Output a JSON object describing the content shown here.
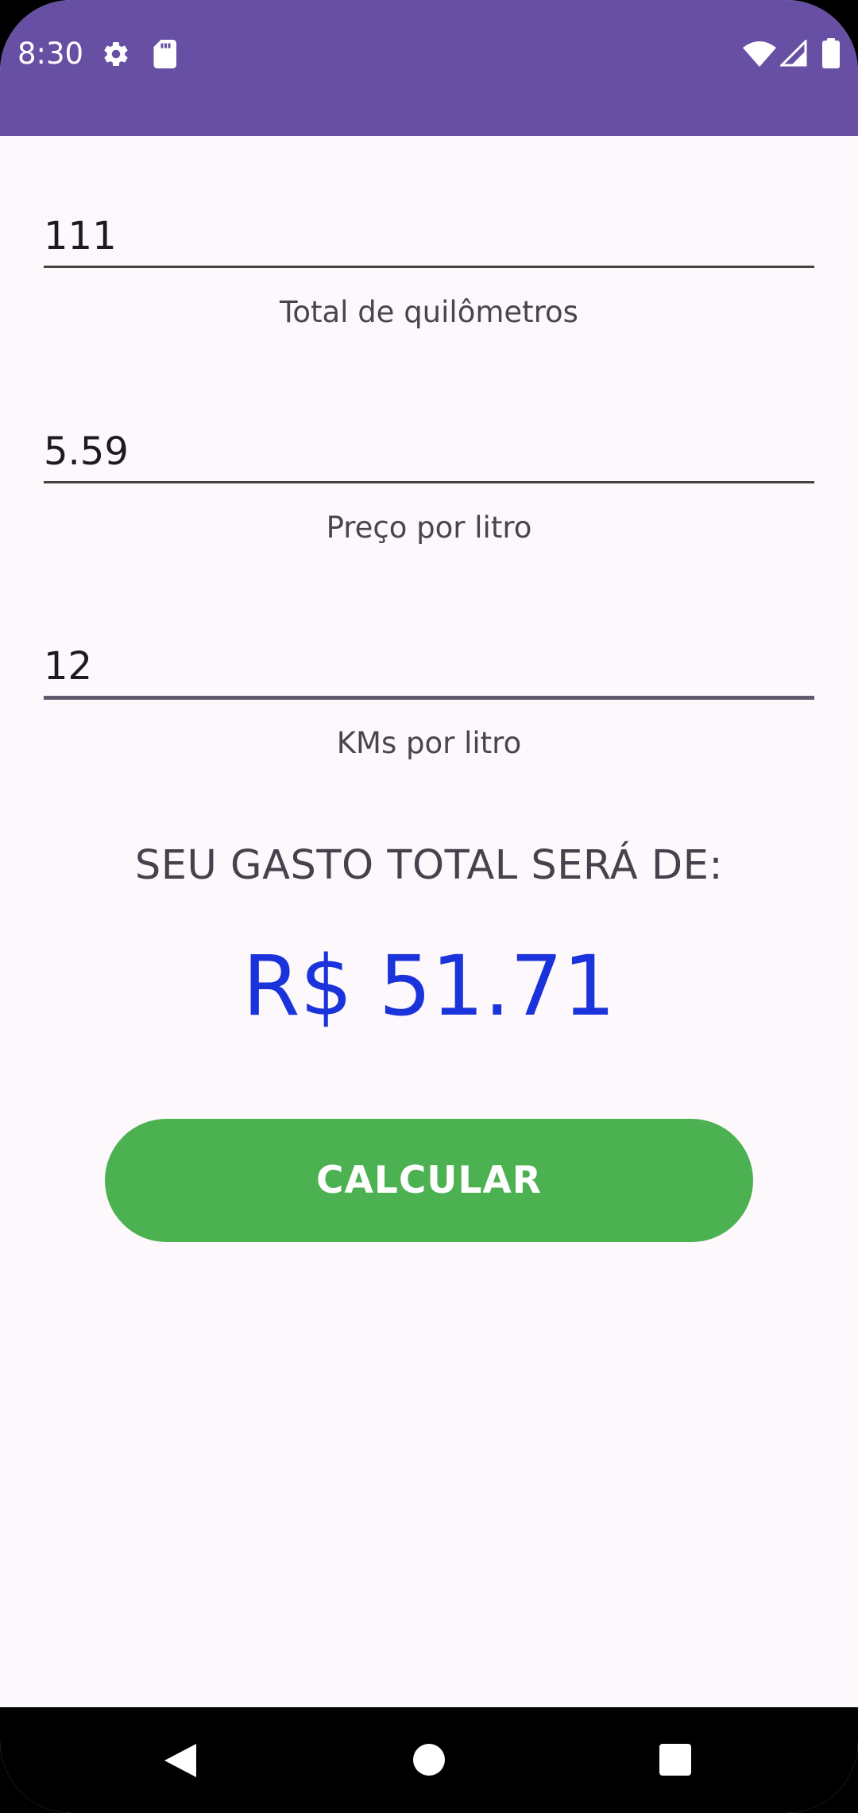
{
  "status_bar": {
    "time": "8:30",
    "icons": [
      "gear-icon",
      "sd-card-icon",
      "wifi-icon",
      "signal-icon",
      "battery-icon"
    ]
  },
  "form": {
    "fields": [
      {
        "value": "111",
        "label": "Total de quilômetros"
      },
      {
        "value": "5.59",
        "label": "Preço por litro"
      },
      {
        "value": "12",
        "label": "KMs por litro"
      }
    ]
  },
  "result": {
    "title": "SEU GASTO TOTAL SERÁ DE:",
    "value": "R$ 51.71"
  },
  "button": {
    "label": "CALCULAR"
  },
  "nav_bar": {
    "icons": [
      "back-icon",
      "home-icon",
      "recents-icon"
    ]
  },
  "colors": {
    "status_bar": "#6750A4",
    "background": "#FDF8FC",
    "result_value": "#1A33DB",
    "button": "#4CB150"
  }
}
